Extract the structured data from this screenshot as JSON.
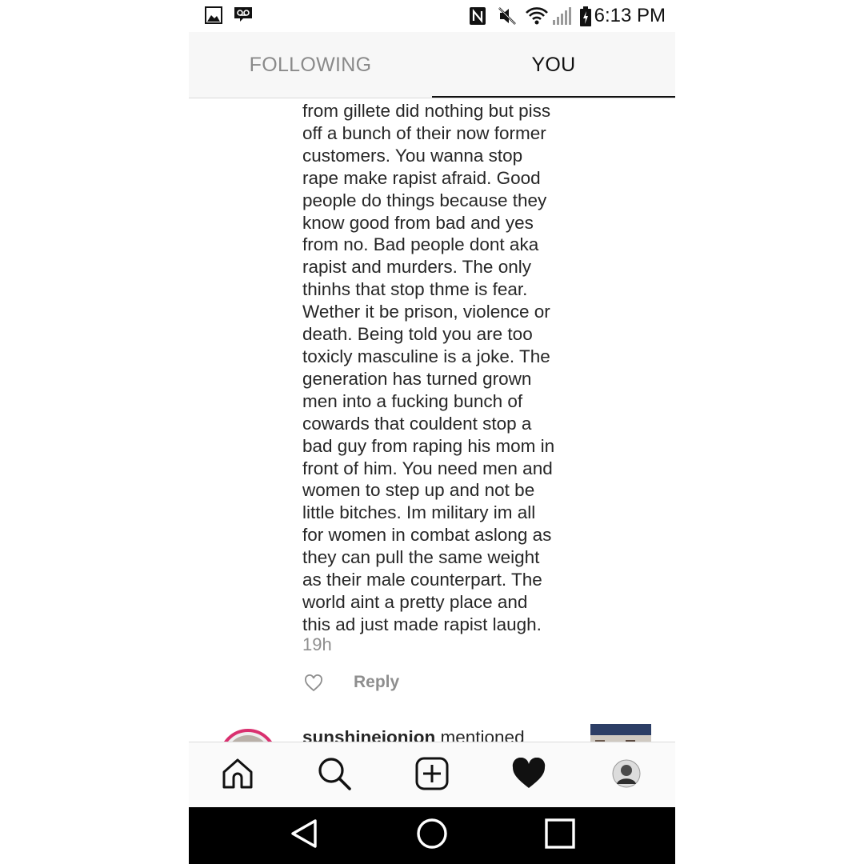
{
  "status_bar": {
    "time": "6:13 PM",
    "icons": [
      "gallery-icon",
      "voicemail-icon",
      "nfc-icon",
      "mute-icon",
      "wifi-icon",
      "signal-icon",
      "battery-charging-icon"
    ]
  },
  "tabs": [
    {
      "label": "FOLLOWING",
      "active": false
    },
    {
      "label": "YOU",
      "active": true
    }
  ],
  "comment": {
    "text": "from gillete did nothing but piss\noff a bunch of their now former\ncustomers. You wanna stop\nrape make rapist afraid. Good\npeople do things because they\nknow good from bad and yes\nfrom no. Bad people dont aka\nrapist and murders. The only\nthinhs that stop thme is fear.\nWether it be prison, violence or\ndeath. Being told you are too\ntoxicly masculine is a joke. The\ngeneration has turned grown\nmen into a fucking bunch of\ncowards that couldent stop a\nbad guy from raping his mom in\nfront of him. You need men and\nwomen to step up and not be\nlittle bitches. Im military im all\nfor women in combat aslong as\nthey can pull the same weight\nas their male counterpart. The\nworld aint a pretty place and\nthis ad just made rapist laugh.",
    "time": "19h",
    "reply_label": "Reply"
  },
  "next_item": {
    "username": "sunshineionion",
    "action": "mentioned"
  },
  "bottom_nav": [
    "home-icon",
    "search-icon",
    "add-post-icon",
    "activity-heart-icon",
    "profile-avatar"
  ],
  "system_nav": [
    "back-icon",
    "home-circle-icon",
    "recents-icon"
  ]
}
